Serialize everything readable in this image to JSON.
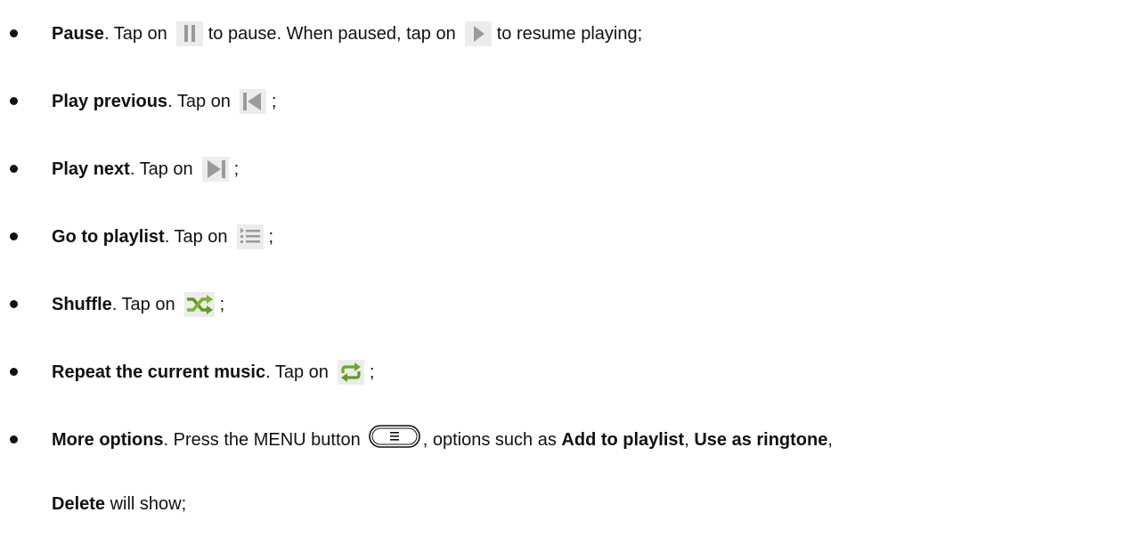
{
  "items": [
    {
      "title": "Pause",
      "text_a": ". Tap on",
      "text_b": "to pause. When paused, tap on",
      "text_c": "to resume playing;",
      "icons": [
        "pause-icon",
        "play-icon"
      ]
    },
    {
      "title": "Play previous",
      "text_a": ". Tap on",
      "text_b": ";",
      "icons": [
        "previous-icon"
      ]
    },
    {
      "title": "Play next",
      "text_a": ". Tap on",
      "text_b": ";",
      "icons": [
        "next-icon"
      ]
    },
    {
      "title": "Go to playlist",
      "text_a": ". Tap on",
      "text_b": ";",
      "icons": [
        "playlist-icon"
      ]
    },
    {
      "title": "Shuffle",
      "text_a": ". Tap on",
      "text_b": ";",
      "icons": [
        "shuffle-icon"
      ]
    },
    {
      "title": "Repeat the current music",
      "text_a": ". Tap on",
      "text_b": ";",
      "icons": [
        "repeat-icon"
      ]
    },
    {
      "title": "More options",
      "text_a": ". Press the MENU button",
      "text_b": ", options such as",
      "opt1": "Add to playlist",
      "sep1": ",",
      "opt2": "Use as ringtone",
      "sep2": ",",
      "opt3": "Delete",
      "text_c": "will show;",
      "icons": [
        "menu-button-icon"
      ]
    }
  ],
  "colors": {
    "icon_grey": "#9a9a9a",
    "icon_bg": "#e6e6e6",
    "icon_green": "#5f9b1e",
    "text": "#111111"
  }
}
